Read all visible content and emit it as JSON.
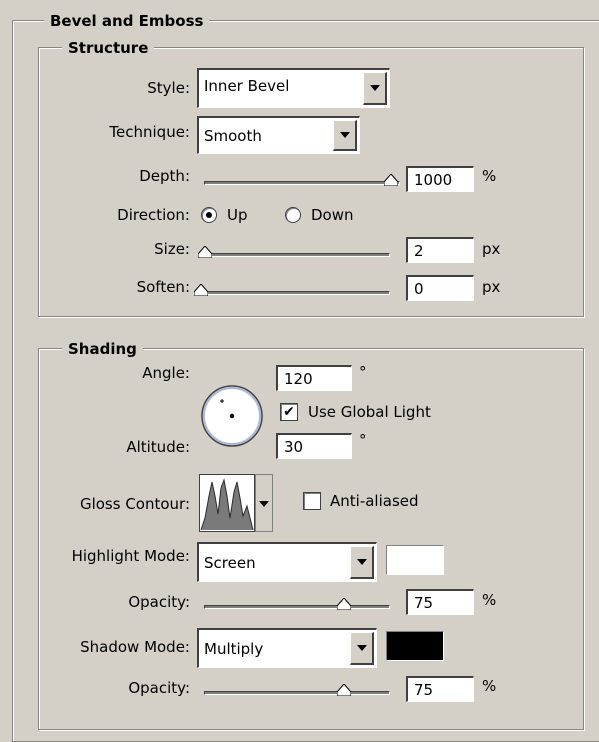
{
  "panel": {
    "title": "Bevel and Emboss"
  },
  "structure": {
    "title": "Structure",
    "style": {
      "label": "Style:",
      "value": "Inner Bevel"
    },
    "technique": {
      "label": "Technique:",
      "value": "Smooth"
    },
    "depth": {
      "label": "Depth:",
      "value": "1000",
      "unit": "%",
      "level": 1.0
    },
    "direction": {
      "label": "Direction:",
      "options": [
        "Up",
        "Down"
      ],
      "selected": "Up"
    },
    "size": {
      "label": "Size:",
      "value": "2",
      "unit": "px",
      "level": 0.0
    },
    "soften": {
      "label": "Soften:",
      "value": "0",
      "unit": "px",
      "level": 0.0
    }
  },
  "shading": {
    "title": "Shading",
    "angle": {
      "label": "Angle:",
      "value": "120",
      "unit": "°"
    },
    "use_global_light": {
      "label": "Use Global Light",
      "checked": true,
      "mark": "✔"
    },
    "altitude": {
      "label": "Altitude:",
      "value": "30",
      "unit": "°"
    },
    "gloss_contour": {
      "label": "Gloss Contour:",
      "icon": "contour-thumbnail-icon"
    },
    "anti_aliased": {
      "label": "Anti-aliased",
      "checked": false
    },
    "highlight_mode": {
      "label": "Highlight Mode:",
      "value": "Screen",
      "color": "#ffffff"
    },
    "highlight_opacity": {
      "label": "Opacity:",
      "value": "75",
      "unit": "%",
      "level": 0.75
    },
    "shadow_mode": {
      "label": "Shadow Mode:",
      "value": "Multiply",
      "color": "#000000"
    },
    "shadow_opacity": {
      "label": "Opacity:",
      "value": "75",
      "unit": "%",
      "level": 0.75
    }
  }
}
